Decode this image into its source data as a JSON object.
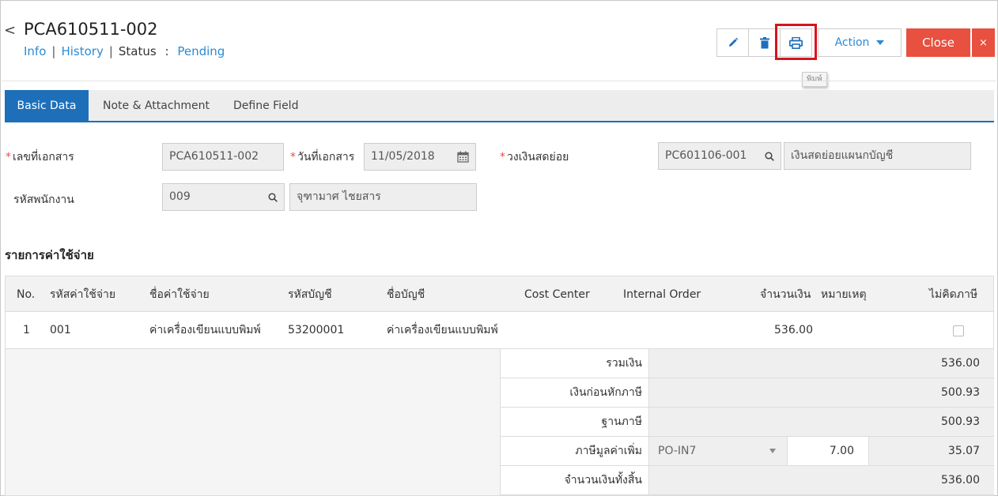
{
  "header": {
    "back_glyph": "<",
    "doc_no": "PCA610511-002",
    "info_link": "Info",
    "history_link": "History",
    "status_label": "Status",
    "status_colon": ":",
    "status_value": "Pending"
  },
  "toolbar": {
    "edit_icon": "pencil-icon",
    "delete_icon": "trash-icon",
    "print_icon": "printer-icon",
    "print_tooltip": "พิมพ์",
    "action_label": "Action",
    "close_label": "Close",
    "close_x": "×"
  },
  "tabs": [
    "Basic Data",
    "Note & Attachment",
    "Define Field"
  ],
  "form": {
    "doc_no_label": "เลขที่เอกสาร",
    "doc_no_value": "PCA610511-002",
    "doc_date_label": "วันที่เอกสาร",
    "doc_date_value": "11/05/2018",
    "petty_cash_label": "วงเงินสดย่อย",
    "petty_cash_code": "PC601106-001",
    "petty_cash_name": "เงินสดย่อยแผนกบัญชี",
    "employee_label": "รหัสพนักงาน",
    "employee_code": "009",
    "employee_name": "จุฑามาศ ไชยสาร"
  },
  "section_title": "รายการค่าใช้จ่าย",
  "grid": {
    "columns": [
      "No.",
      "รหัสค่าใช้จ่าย",
      "ชื่อค่าใช้จ่าย",
      "รหัสบัญชี",
      "ชื่อบัญชี",
      "Cost Center",
      "Internal Order",
      "จำนวนเงิน",
      "หมายเหตุ",
      "ไม่คิดภาษี"
    ],
    "rows": [
      {
        "no": "1",
        "expense_code": "001",
        "expense_name": "ค่าเครื่องเขียนแบบพิมพ์",
        "account_code": "53200001",
        "account_name": "ค่าเครื่องเขียนแบบพิมพ์",
        "cost_center": "",
        "internal_order": "",
        "amount": "536.00",
        "remark": "",
        "no_tax": false
      }
    ]
  },
  "summary": {
    "total_label": "รวมเงิน",
    "total_value": "536.00",
    "before_tax_label": "เงินก่อนหักภาษี",
    "before_tax_value": "500.93",
    "tax_base_label": "ฐานภาษี",
    "tax_base_value": "500.93",
    "vat_label": "ภาษีมูลค่าเพิ่ม",
    "vat_code": "PO-IN7",
    "vat_rate": "7.00",
    "vat_amount": "35.07",
    "grand_total_label": "จำนวนเงินทั้งสิ้น",
    "grand_total_value": "536.00"
  },
  "colors": {
    "link": "#2a8bd4",
    "tab_active": "#1e6fba",
    "close": "#e8503f",
    "highlight": "#d9131c"
  }
}
